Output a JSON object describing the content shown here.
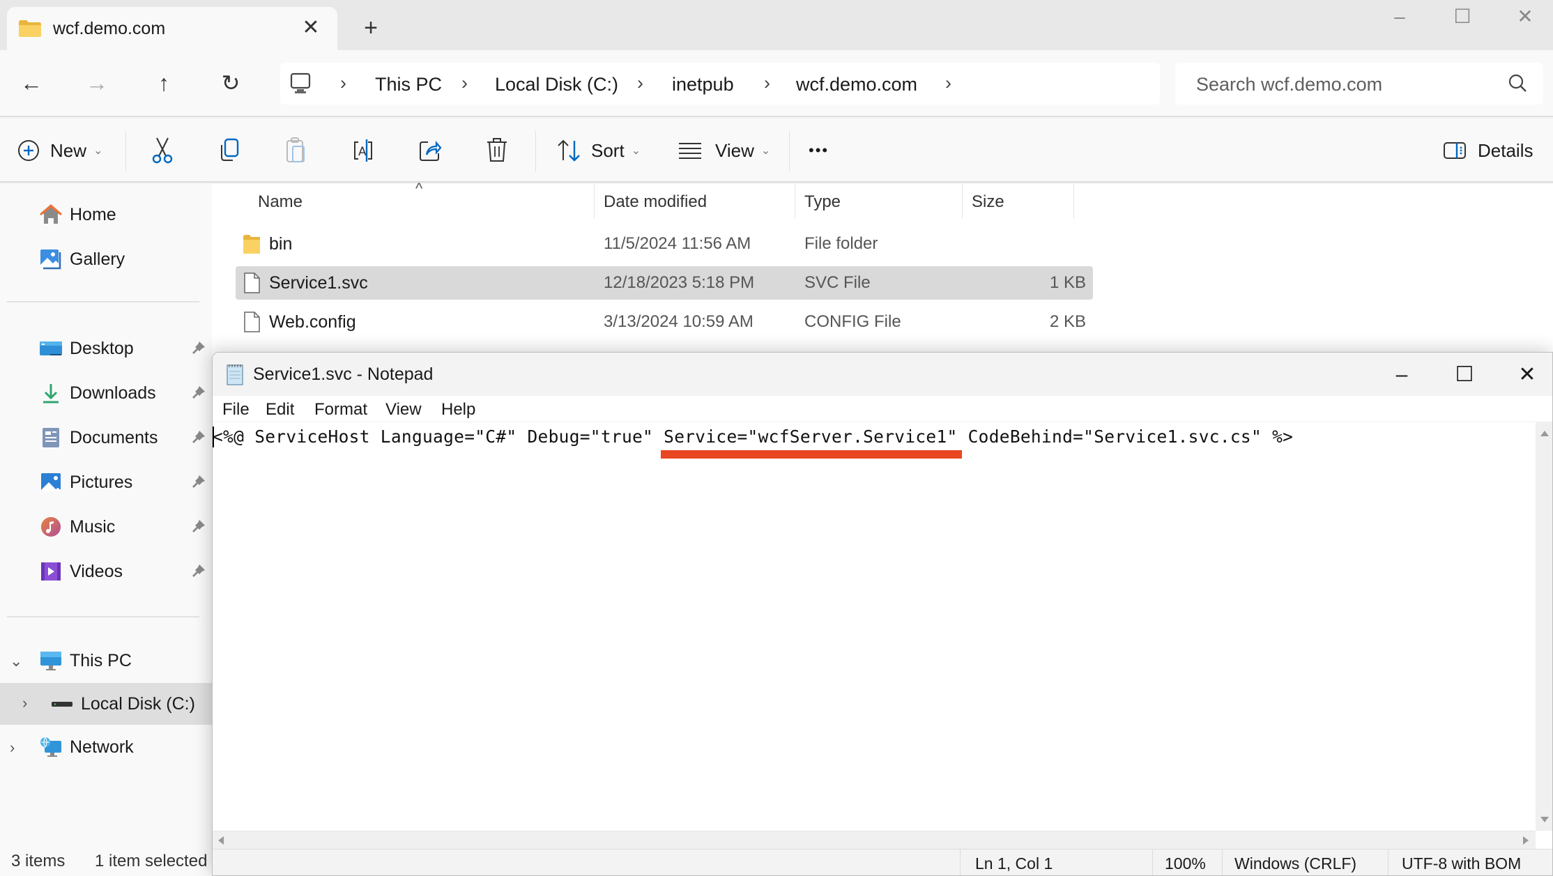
{
  "explorer": {
    "tab": {
      "title": "wcf.demo.com",
      "close_glyph": "✕",
      "icon": "folder-icon"
    },
    "new_tab_glyph": "+",
    "window_controls": {
      "minimize": "–",
      "maximize": "☐",
      "close": "✕"
    },
    "nav": {
      "back": "←",
      "forward": "→",
      "up": "↑",
      "refresh": "↻"
    },
    "breadcrumb": [
      "This PC",
      "Local Disk (C:)",
      "inetpub",
      "wcf.demo.com"
    ],
    "breadcrumb_sep": "›",
    "search": {
      "placeholder": "Search wcf.demo.com"
    },
    "commands": {
      "new": "New",
      "sort": "Sort",
      "view": "View",
      "more": "•••",
      "details": "Details",
      "chevron": "⌄"
    },
    "sidebar": {
      "top": [
        {
          "label": "Home",
          "icon": "home-icon"
        },
        {
          "label": "Gallery",
          "icon": "gallery-icon"
        }
      ],
      "pinned": [
        {
          "label": "Desktop",
          "icon": "desktop-icon"
        },
        {
          "label": "Downloads",
          "icon": "downloads-icon"
        },
        {
          "label": "Documents",
          "icon": "documents-icon"
        },
        {
          "label": "Pictures",
          "icon": "pictures-icon"
        },
        {
          "label": "Music",
          "icon": "music-icon"
        },
        {
          "label": "Videos",
          "icon": "videos-icon"
        }
      ],
      "tree": [
        {
          "label": "This PC",
          "expander": "⌄",
          "icon": "this-pc-icon"
        },
        {
          "label": "Local Disk (C:)",
          "expander": "›",
          "icon": "drive-icon",
          "selected": true
        },
        {
          "label": "Network",
          "expander": "›",
          "icon": "network-icon"
        }
      ]
    },
    "columns": {
      "name": "Name",
      "date": "Date modified",
      "type": "Type",
      "size": "Size",
      "sort_caret": "^"
    },
    "files": [
      {
        "name": "bin",
        "date": "11/5/2024 11:56 AM",
        "type": "File folder",
        "size": "",
        "icon": "folder-icon"
      },
      {
        "name": "Service1.svc",
        "date": "12/18/2023 5:18 PM",
        "type": "SVC File",
        "size": "1 KB",
        "icon": "file-icon",
        "selected": true
      },
      {
        "name": "Web.config",
        "date": "3/13/2024 10:59 AM",
        "type": "CONFIG File",
        "size": "2 KB",
        "icon": "file-icon"
      }
    ],
    "status": {
      "count": "3 items",
      "selected": "1 item selected"
    }
  },
  "notepad": {
    "title": "Service1.svc - Notepad",
    "controls": {
      "minimize": "–",
      "maximize": "☐",
      "close": "✕"
    },
    "menu": [
      "File",
      "Edit",
      "Format",
      "View",
      "Help"
    ],
    "content": "<%@ ServiceHost Language=\"C#\" Debug=\"true\" Service=\"wcfServer.Service1\" CodeBehind=\"Service1.svc.cs\" %>",
    "highlight": {
      "text": "Service=\"wcfServer.Service1\"",
      "color": "#e84722"
    },
    "status": {
      "position": "Ln 1, Col 1",
      "zoom": "100%",
      "line_ending": "Windows (CRLF)",
      "encoding": "UTF-8 with BOM"
    }
  },
  "colors": {
    "accent": "#0067c0",
    "selection": "#d9d9d9",
    "annotation": "#e84722",
    "folder": "#f5c542"
  }
}
